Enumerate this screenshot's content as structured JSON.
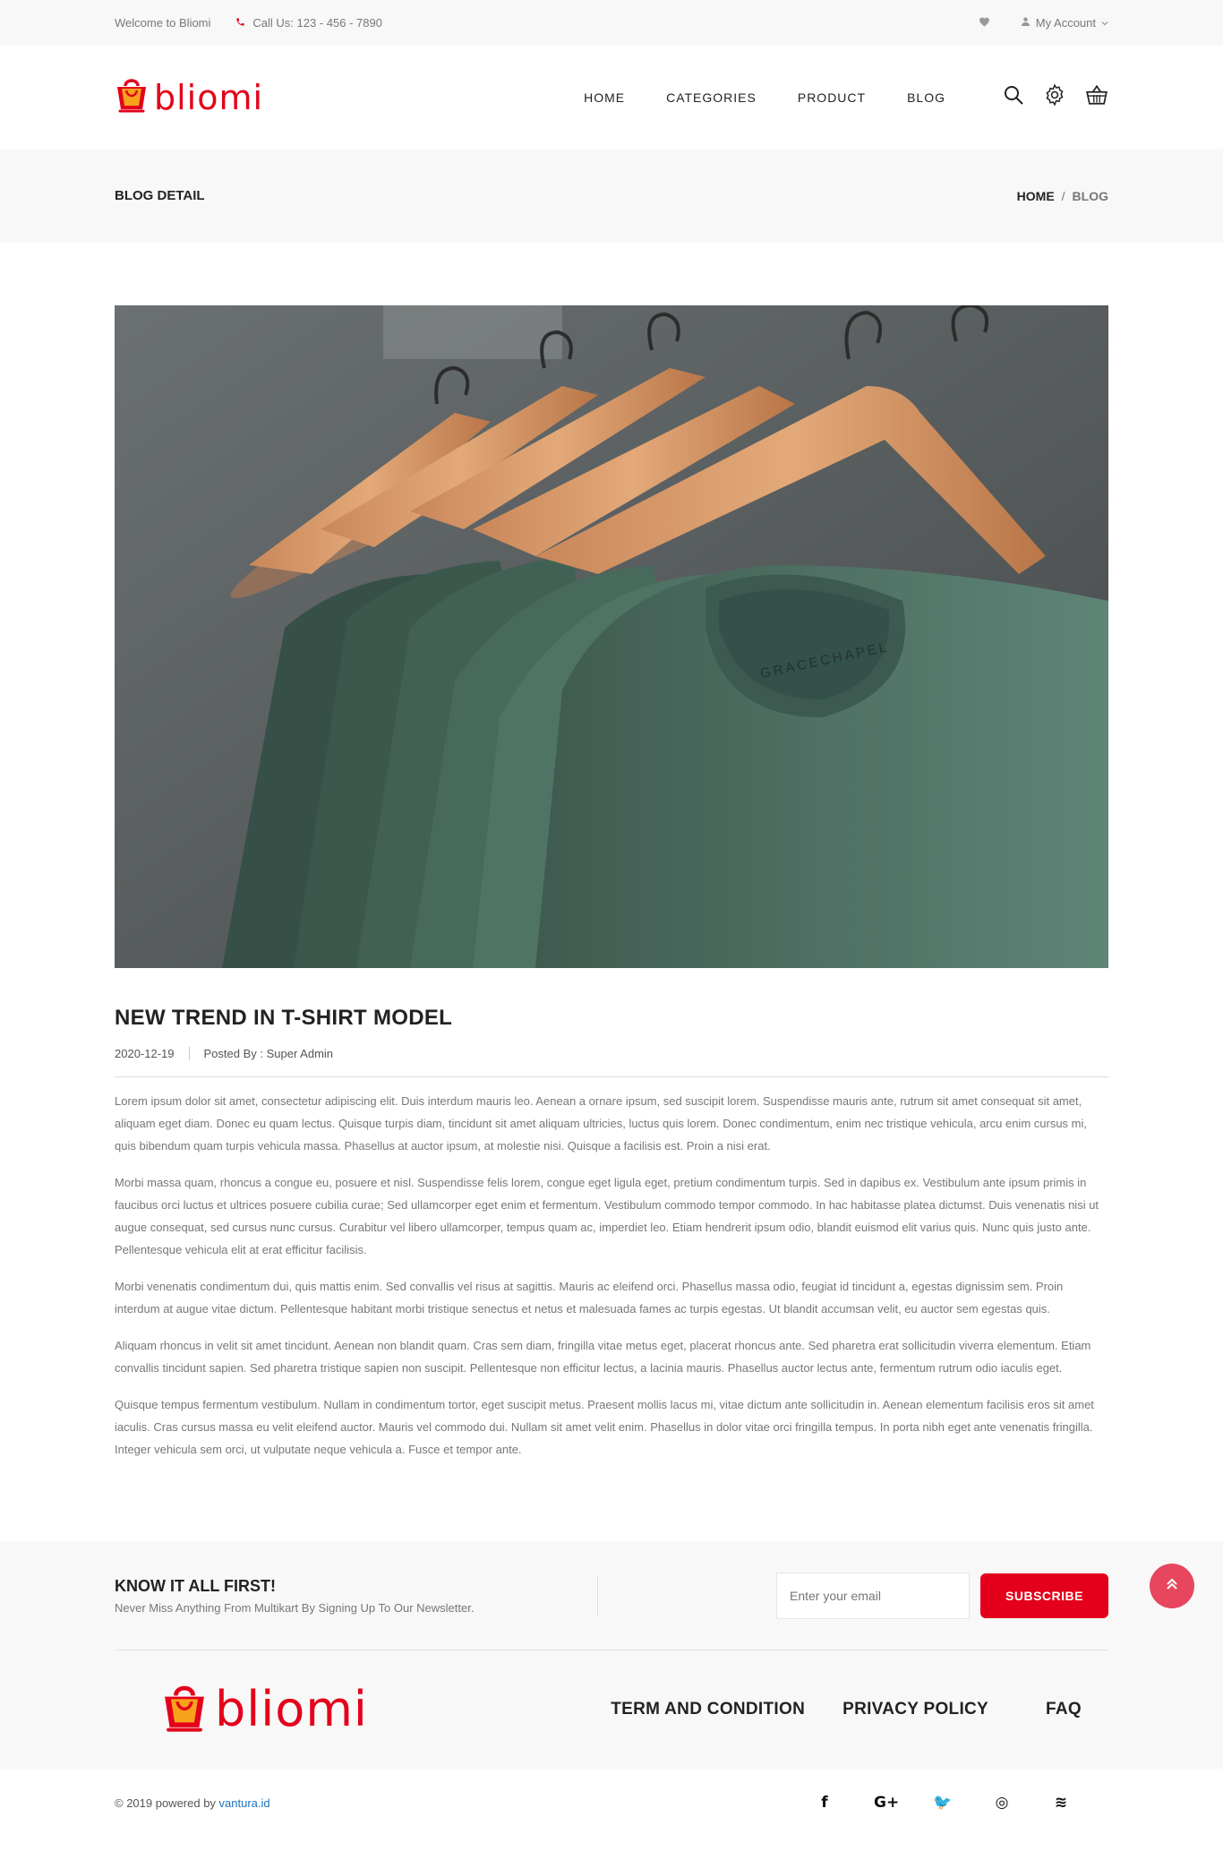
{
  "topbar": {
    "welcome": "Welcome to Bliomi",
    "phone": "Call Us: 123 - 456 - 7890",
    "account": "My Account"
  },
  "header": {
    "logo_text": "bliomi",
    "menu": [
      "HOME",
      "CATEGORIES",
      "PRODUCT",
      "BLOG"
    ],
    "icons": [
      "search-icon",
      "settings-icon",
      "basket-icon"
    ]
  },
  "breadcrumb": {
    "title": "BLOG DETAIL",
    "items": [
      "HOME",
      "BLOG"
    ],
    "separator": "/"
  },
  "post": {
    "image_alt": "Green t-shirts on wooden hangers",
    "label_text": "GRACECHAPEL",
    "title": "NEW TREND IN T-SHIRT MODEL",
    "date": "2020-12-19",
    "author": "Posted By : Super Admin",
    "paragraphs": [
      "Lorem ipsum dolor sit amet, consectetur adipiscing elit. Duis interdum mauris leo. Aenean a ornare ipsum, sed suscipit lorem. Suspendisse mauris ante, rutrum sit amet consequat sit amet, aliquam eget diam. Donec eu quam lectus. Quisque turpis diam, tincidunt sit amet aliquam ultricies, luctus quis lorem. Donec condimentum, enim nec tristique vehicula, arcu enim cursus mi, quis bibendum quam turpis vehicula massa. Phasellus at auctor ipsum, at molestie nisi. Quisque a facilisis est. Proin a nisi erat.",
      "Morbi massa quam, rhoncus a congue eu, posuere et nisl. Suspendisse felis lorem, congue eget ligula eget, pretium condimentum turpis. Sed in dapibus ex. Vestibulum ante ipsum primis in faucibus orci luctus et ultrices posuere cubilia curae; Sed ullamcorper eget enim et fermentum. Vestibulum commodo tempor commodo. In hac habitasse platea dictumst. Duis venenatis nisi ut augue consequat, sed cursus nunc cursus. Curabitur vel libero ullamcorper, tempus quam ac, imperdiet leo. Etiam hendrerit ipsum odio, blandit euismod elit varius quis. Nunc quis justo ante. Pellentesque vehicula elit at erat efficitur facilisis.",
      "Morbi venenatis condimentum dui, quis mattis enim. Sed convallis vel risus at sagittis. Mauris ac eleifend orci. Phasellus massa odio, feugiat id tincidunt a, egestas dignissim sem. Proin interdum at augue vitae dictum. Pellentesque habitant morbi tristique senectus et netus et malesuada fames ac turpis egestas. Ut blandit accumsan velit, eu auctor sem egestas quis.",
      "Aliquam rhoncus in velit sit amet tincidunt. Aenean non blandit quam. Cras sem diam, fringilla vitae metus eget, placerat rhoncus ante. Sed pharetra erat sollicitudin viverra elementum. Etiam convallis tincidunt sapien. Sed pharetra tristique sapien non suscipit. Pellentesque non efficitur lectus, a lacinia mauris. Phasellus auctor lectus ante, fermentum rutrum odio iaculis eget.",
      "Quisque tempus fermentum vestibulum. Nullam in condimentum tortor, eget suscipit metus. Praesent mollis lacus mi, vitae dictum ante sollicitudin in. Aenean elementum facilisis eros sit amet iaculis. Cras cursus massa eu velit eleifend auctor. Mauris vel commodo dui. Nullam sit amet velit enim. Phasellus in dolor vitae orci fringilla tempus. In porta nibh eget ante venenatis fringilla. Integer vehicula sem orci, ut vulputate neque vehicula a. Fusce et tempor ante."
    ]
  },
  "newsletter": {
    "title": "KNOW IT ALL FIRST!",
    "subtitle": "Never Miss Anything From Multikart By Signing Up To Our Newsletter.",
    "placeholder": "Enter your email",
    "button": "SUBSCRIBE"
  },
  "footer": {
    "logo_text": "bliomi",
    "links": [
      "TERM AND CONDITION",
      "PRIVACY POLICY",
      "FAQ"
    ],
    "copyright_prefix": "© 2019 powered by ",
    "copyright_brand": "vantura.id",
    "socials": [
      {
        "icon": "facebook-icon",
        "glyph": "f"
      },
      {
        "icon": "google-plus-icon",
        "glyph": "G+"
      },
      {
        "icon": "twitter-icon",
        "glyph": "🐦"
      },
      {
        "icon": "instagram-icon",
        "glyph": "◎"
      },
      {
        "icon": "rss-icon",
        "glyph": "≋"
      }
    ]
  },
  "colors": {
    "accent": "#e4001b",
    "scroll_top": "#e6475f",
    "link": "#1e73be"
  }
}
